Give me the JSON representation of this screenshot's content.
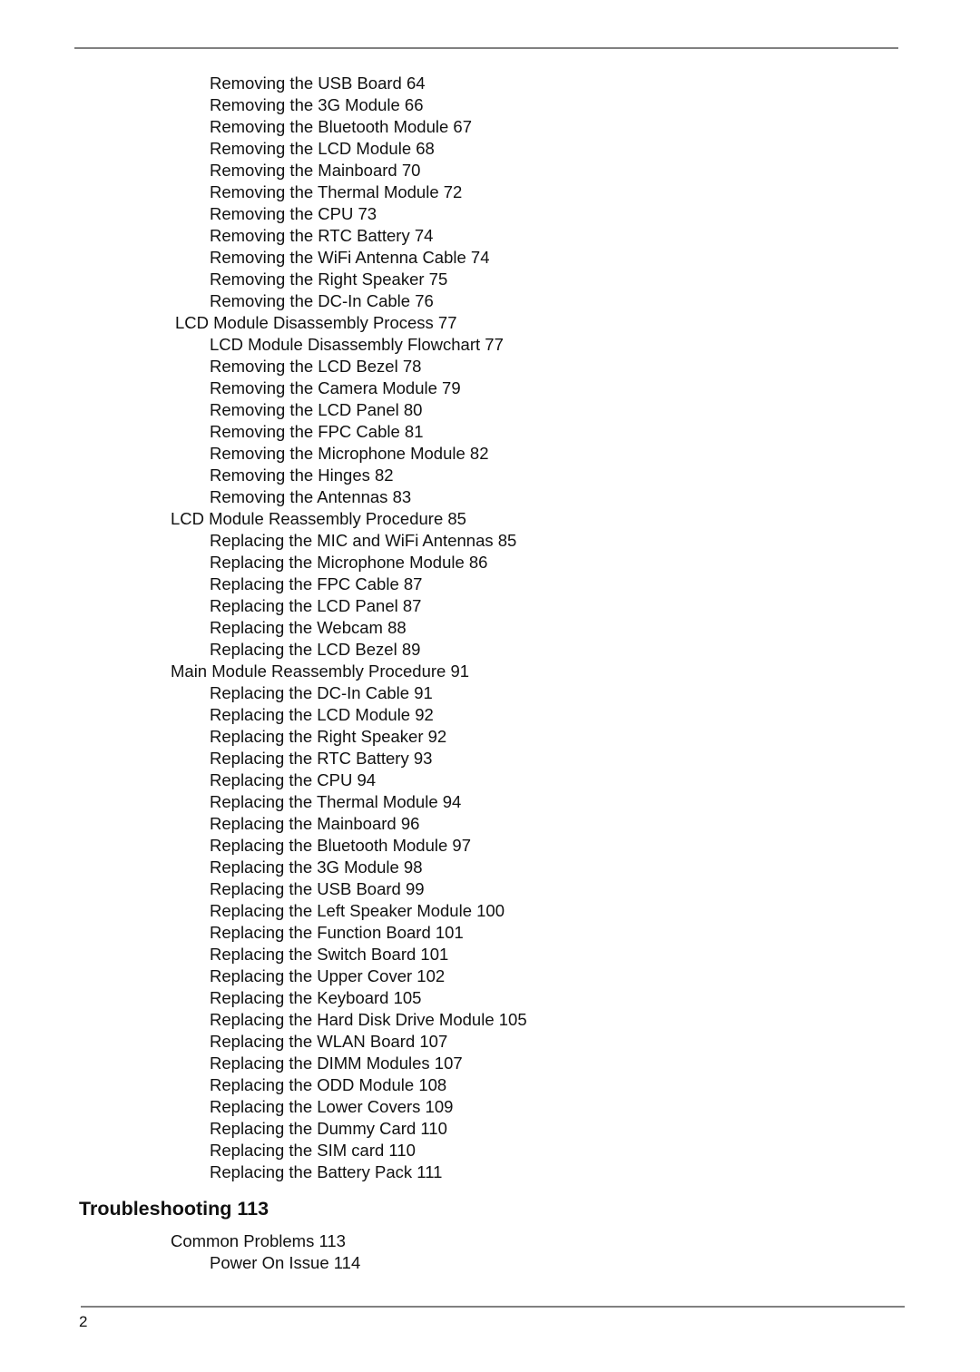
{
  "toc": {
    "entries_top": [
      {
        "text": "Removing the USB Board 64",
        "level": 3
      },
      {
        "text": "Removing the 3G Module 66",
        "level": 3
      },
      {
        "text": "Removing the Bluetooth Module 67",
        "level": 3
      },
      {
        "text": "Removing the LCD Module 68",
        "level": 3
      },
      {
        "text": "Removing the Mainboard 70",
        "level": 3
      },
      {
        "text": "Removing the Thermal Module 72",
        "level": 3
      },
      {
        "text": "Removing the CPU 73",
        "level": 3
      },
      {
        "text": "Removing the RTC Battery 74",
        "level": 3
      },
      {
        "text": "Removing the WiFi Antenna Cable 74",
        "level": 3
      },
      {
        "text": "Removing the Right Speaker 75",
        "level": 3
      },
      {
        "text": "Removing the DC-In Cable 76",
        "level": 3
      },
      {
        "text": "LCD Module Disassembly Process 77",
        "level": 2
      },
      {
        "text": "LCD Module Disassembly Flowchart 77",
        "level": 3
      },
      {
        "text": "Removing the LCD Bezel 78",
        "level": 3
      },
      {
        "text": "Removing the Camera Module 79",
        "level": 3
      },
      {
        "text": "Removing the LCD Panel 80",
        "level": 3
      },
      {
        "text": "Removing the FPC Cable 81",
        "level": 3
      },
      {
        "text": "Removing the Microphone Module 82",
        "level": 3
      },
      {
        "text": "Removing the Hinges 82",
        "level": 3
      },
      {
        "text": "Removing the Antennas 83",
        "level": 3
      },
      {
        "text": "LCD Module Reassembly Procedure 85",
        "level": 2
      },
      {
        "text": "Replacing the MIC and WiFi Antennas 85",
        "level": 3
      },
      {
        "text": "Replacing the Microphone Module 86",
        "level": 3
      },
      {
        "text": "Replacing the FPC Cable 87",
        "level": 3
      },
      {
        "text": "Replacing the LCD Panel 87",
        "level": 3
      },
      {
        "text": "Replacing the Webcam 88",
        "level": 3
      },
      {
        "text": "Replacing the LCD Bezel 89",
        "level": 3
      },
      {
        "text": "Main Module Reassembly Procedure 91",
        "level": 2
      },
      {
        "text": "Replacing the DC-In Cable 91",
        "level": 3
      },
      {
        "text": "Replacing the LCD Module 92",
        "level": 3
      },
      {
        "text": "Replacing the Right Speaker 92",
        "level": 3
      },
      {
        "text": "Replacing the RTC Battery 93",
        "level": 3
      },
      {
        "text": "Replacing the CPU 94",
        "level": 3
      },
      {
        "text": "Replacing the Thermal Module 94",
        "level": 3
      },
      {
        "text": "Replacing the Mainboard 96",
        "level": 3
      },
      {
        "text": "Replacing the Bluetooth Module 97",
        "level": 3
      },
      {
        "text": "Replacing the 3G Module 98",
        "level": 3
      },
      {
        "text": "Replacing the USB Board 99",
        "level": 3
      },
      {
        "text": "Replacing the Left Speaker Module 100",
        "level": 3
      },
      {
        "text": "Replacing the Function Board 101",
        "level": 3
      },
      {
        "text": "Replacing the Switch Board 101",
        "level": 3
      },
      {
        "text": "Replacing the Upper Cover 102",
        "level": 3
      },
      {
        "text": "Replacing the Keyboard 105",
        "level": 3
      },
      {
        "text": "Replacing the Hard Disk Drive Module 105",
        "level": 3
      },
      {
        "text": "Replacing the WLAN Board 107",
        "level": 3
      },
      {
        "text": "Replacing the DIMM Modules 107",
        "level": 3
      },
      {
        "text": "Replacing the ODD Module 108",
        "level": 3
      },
      {
        "text": "Replacing the Lower Covers 109",
        "level": 3
      },
      {
        "text": "Replacing the Dummy Card 110",
        "level": 3
      },
      {
        "text": "Replacing the SIM card 110",
        "level": 3
      },
      {
        "text": "Replacing the Battery Pack 111",
        "level": 3
      }
    ],
    "chapter": {
      "text": "Troubleshooting 113",
      "level": 1
    },
    "entries_bottom": [
      {
        "text": "Common Problems 113",
        "level": 2
      },
      {
        "text": "Power On Issue 114",
        "level": 3
      }
    ]
  },
  "footer": {
    "page_number": "2"
  }
}
